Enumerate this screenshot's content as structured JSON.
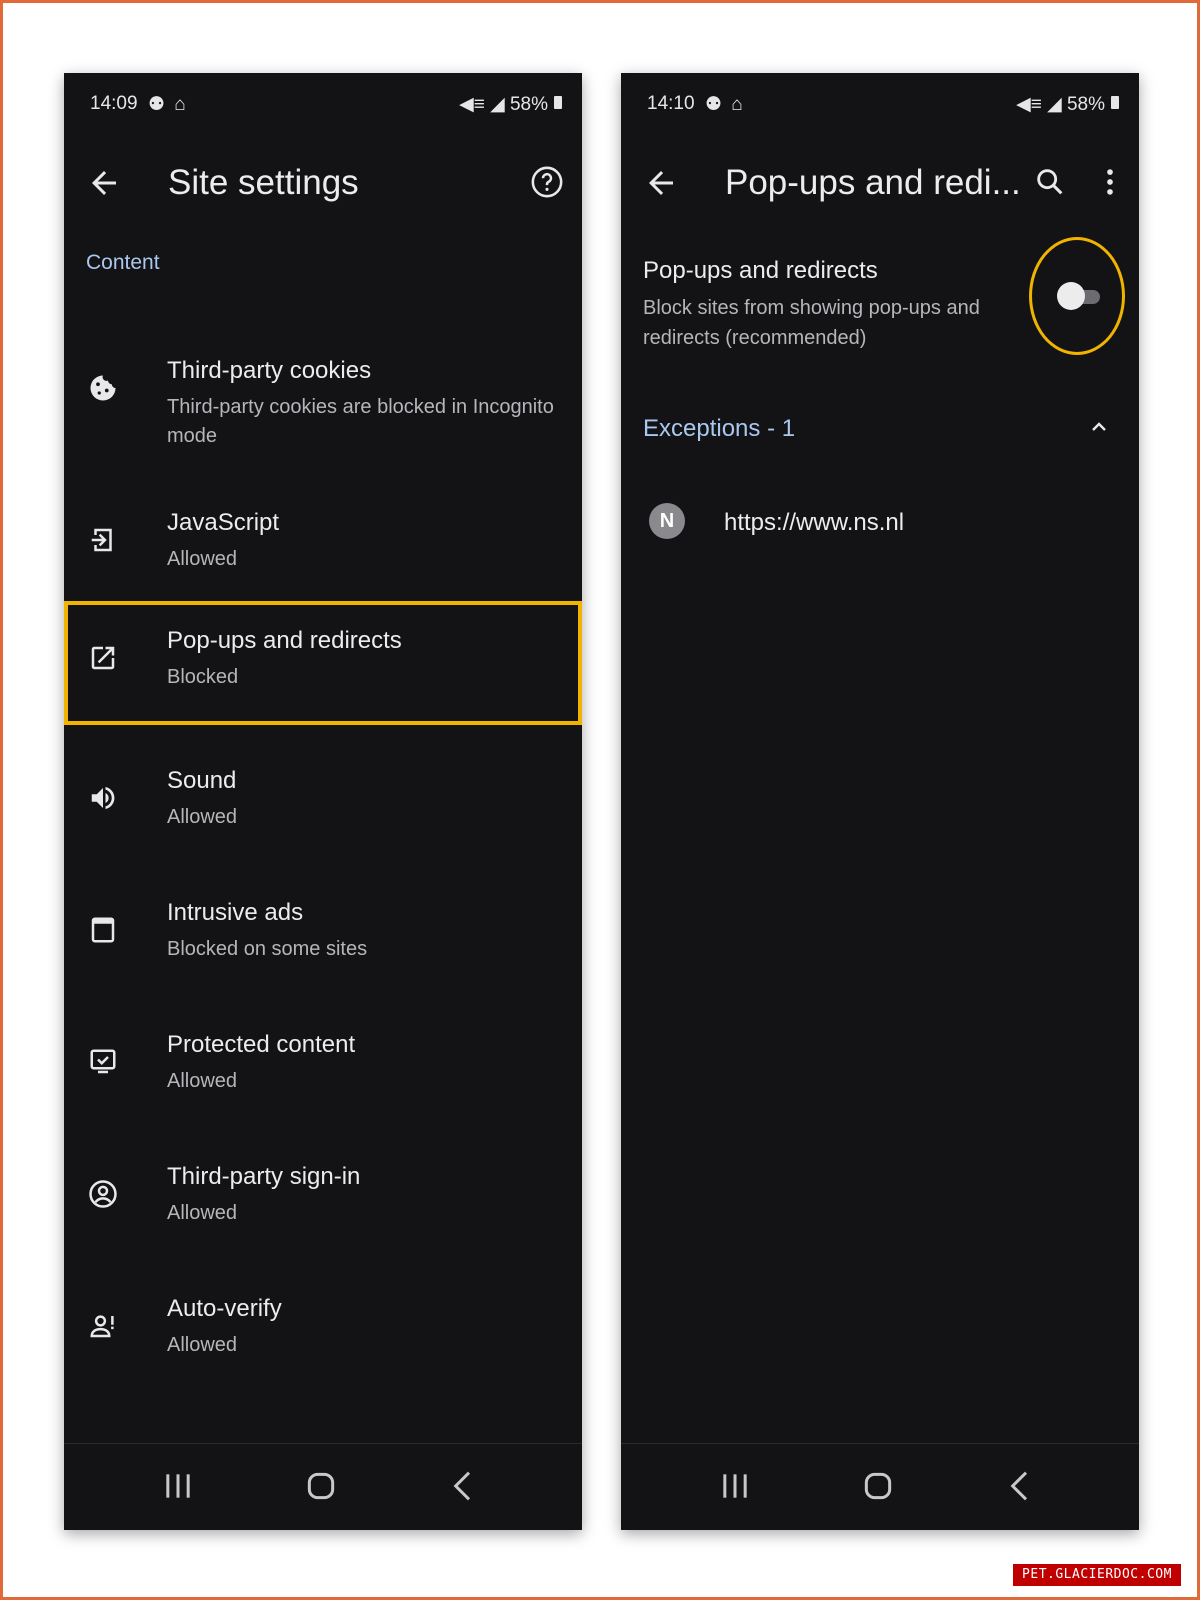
{
  "left_screen": {
    "status": {
      "time": "14:09",
      "notif_icons": "⚉ ⌂",
      "system": "◀≡ ◢ 58%"
    },
    "app_bar": {
      "title": "Site settings"
    },
    "section_header": "Content",
    "items": [
      {
        "label": "Third-party cookies",
        "sub": "Third-party cookies are blocked in Incognito mode",
        "icon": "cookie-icon"
      },
      {
        "label": "JavaScript",
        "sub": "Allowed",
        "icon": "javascript-icon"
      },
      {
        "label": "Pop-ups and redirects",
        "sub": "Blocked",
        "icon": "open-in-new-icon"
      },
      {
        "label": "Sound",
        "sub": "Allowed",
        "icon": "volume-icon"
      },
      {
        "label": "Intrusive ads",
        "sub": "Blocked on some sites",
        "icon": "ads-icon"
      },
      {
        "label": "Protected content",
        "sub": "Allowed",
        "icon": "protected-content-icon"
      },
      {
        "label": "Third-party sign-in",
        "sub": "Allowed",
        "icon": "account-circle-icon"
      },
      {
        "label": "Auto-verify",
        "sub": "Allowed",
        "icon": "auto-verify-icon"
      }
    ]
  },
  "right_screen": {
    "status": {
      "time": "14:10",
      "notif_icons": "⚉ ⌂",
      "system": "◀≡ ◢ 58%"
    },
    "app_bar": {
      "title": "Pop-ups and redi..."
    },
    "preference": {
      "title": "Pop-ups and redirects",
      "subtitle": "Block sites from showing pop-ups and redirects (recommended)",
      "toggle_on": false
    },
    "exceptions_header": "Exceptions - 1",
    "exceptions": [
      {
        "favicon_letter": "N",
        "url": "https://www.ns.nl"
      }
    ]
  },
  "colors": {
    "background": "#131316",
    "accent": "#aac7ee",
    "highlight": "#f0b400",
    "frame": "#e06a3a"
  },
  "watermark": "PET.GLACIERDOC.COM"
}
